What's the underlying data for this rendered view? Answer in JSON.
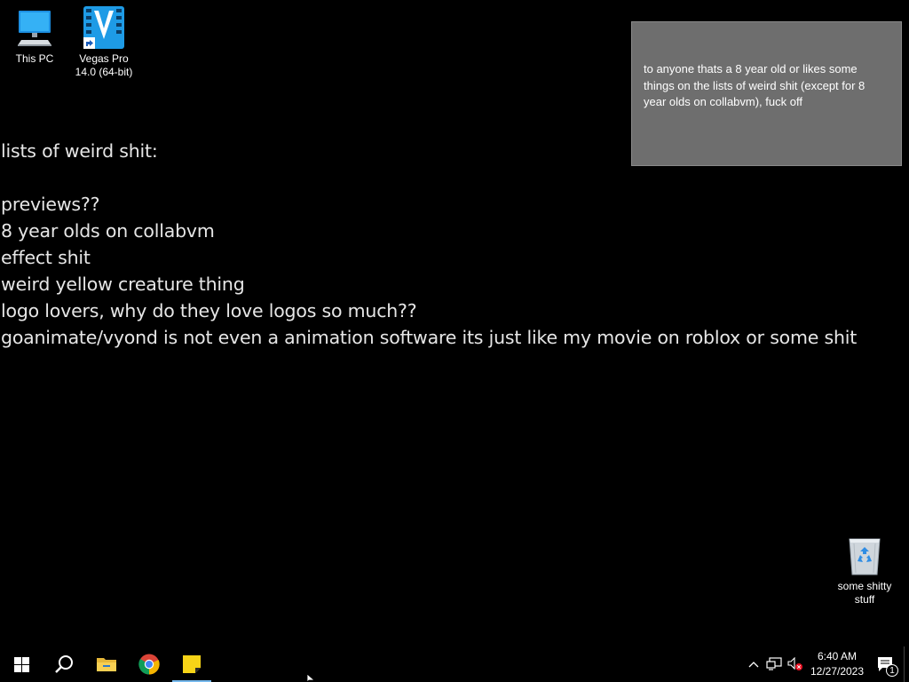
{
  "desktop_icons": {
    "this_pc": {
      "label": "This PC",
      "icon": "computer-icon"
    },
    "vegas": {
      "label_line1": "Vegas Pro",
      "label_line2": "14.0 (64-bit)",
      "icon": "vegas-pro-shortcut-icon"
    },
    "recycle_bin": {
      "label_line1": "some shitty",
      "label_line2": "stuff",
      "icon": "recycle-bin-icon"
    }
  },
  "note": {
    "text": "to anyone thats a 8 year old or likes some things on the lists of weird shit (except for 8 year olds on collabvm), fuck off",
    "background": "#6e6e6e"
  },
  "wallpaper": {
    "heading": "lists of weird shit:",
    "items": [
      "previews??",
      "8 year olds on collabvm",
      "effect shit",
      "weird yellow creature thing",
      "logo lovers, why do they love logos so much??",
      "goanimate/vyond is not even a animation software its just like my movie on roblox or some shit"
    ]
  },
  "taskbar": {
    "pinned": [
      {
        "name": "start",
        "icon": "windows-logo-icon"
      },
      {
        "name": "search",
        "icon": "search-icon"
      },
      {
        "name": "file-explorer",
        "icon": "folder-icon"
      },
      {
        "name": "chrome",
        "icon": "chrome-icon"
      },
      {
        "name": "sticky-notes",
        "icon": "sticky-notes-icon",
        "active": true
      }
    ],
    "tray": {
      "time": "6:40 AM",
      "date": "12/27/2023",
      "notification_count": "1"
    },
    "accent": "#76b9ed"
  }
}
